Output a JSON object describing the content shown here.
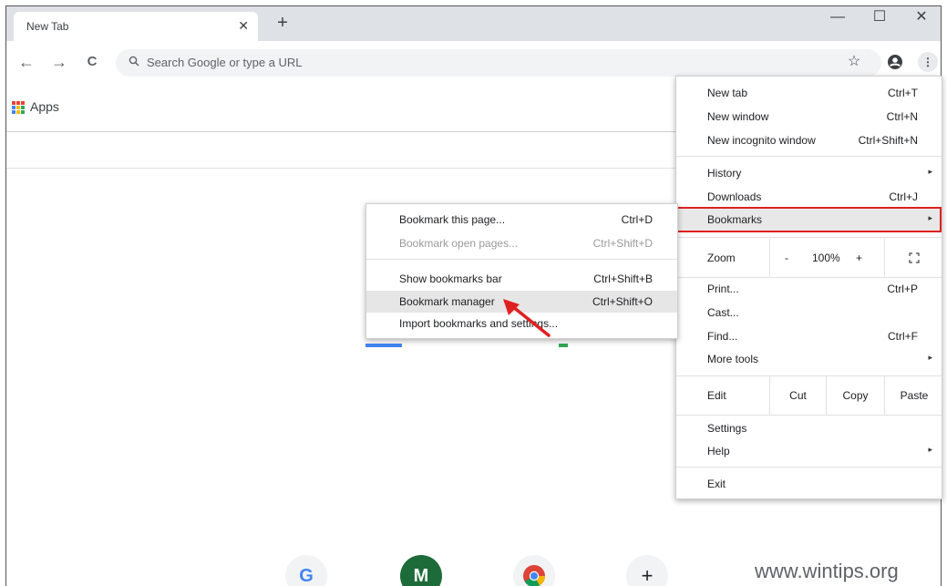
{
  "tab": {
    "title": "New Tab",
    "close": "✕",
    "new_tab": "+"
  },
  "window": {
    "minimize": "—",
    "maximize": "☐",
    "close": "✕"
  },
  "toolbar": {
    "back": "←",
    "forward": "→",
    "reload": "C",
    "search_icon": "🔍",
    "omnibox_placeholder": "Search Google or type a URL",
    "star": "☆",
    "profile": "👤",
    "menu": "⋮"
  },
  "bookmarks_bar": {
    "apps_label": "Apps"
  },
  "main_menu": {
    "items": [
      {
        "label": "New tab",
        "shortcut": "Ctrl+T"
      },
      {
        "label": "New window",
        "shortcut": "Ctrl+N"
      },
      {
        "label": "New incognito window",
        "shortcut": "Ctrl+Shift+N"
      },
      {
        "label": "History",
        "shortcut": ""
      },
      {
        "label": "Downloads",
        "shortcut": "Ctrl+J"
      },
      {
        "label": "Bookmarks",
        "shortcut": ""
      },
      {
        "label": "Print...",
        "shortcut": "Ctrl+P"
      },
      {
        "label": "Cast...",
        "shortcut": ""
      },
      {
        "label": "Find...",
        "shortcut": "Ctrl+F"
      },
      {
        "label": "More tools",
        "shortcut": ""
      },
      {
        "label": "Settings",
        "shortcut": ""
      },
      {
        "label": "Help",
        "shortcut": ""
      },
      {
        "label": "Exit",
        "shortcut": ""
      }
    ],
    "zoom": {
      "label": "Zoom",
      "minus": "-",
      "value": "100%",
      "plus": "+",
      "fullscreen": "⛶"
    },
    "edit": {
      "label": "Edit",
      "cut": "Cut",
      "copy": "Copy",
      "paste": "Paste"
    },
    "submenu_arrow": "▸"
  },
  "bookmarks_submenu": {
    "items": [
      {
        "label": "Bookmark this page...",
        "shortcut": "Ctrl+D"
      },
      {
        "label": "Bookmark open pages...",
        "shortcut": "Ctrl+Shift+D"
      },
      {
        "label": "Show bookmarks bar",
        "shortcut": "Ctrl+Shift+B"
      },
      {
        "label": "Bookmark manager",
        "shortcut": "Ctrl+Shift+O"
      },
      {
        "label": "Import bookmarks and settings...",
        "shortcut": ""
      }
    ]
  },
  "tiles": {
    "google": "G",
    "m": "M",
    "chrome": "",
    "add": "+"
  },
  "watermark": "www.wintips.org",
  "colors": {
    "highlight_border": "#e02020",
    "arrow": "#e02020",
    "tab_strip": "#dee1e6"
  }
}
